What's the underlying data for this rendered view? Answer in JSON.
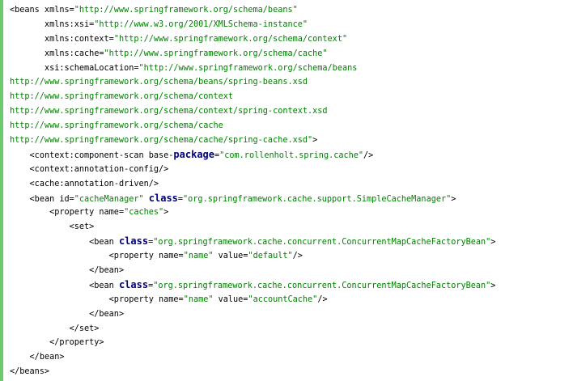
{
  "colors": {
    "left_bar": "#6ccb6c",
    "text": "#000000",
    "string": "#008000",
    "keyword": "#000080"
  },
  "lines": [
    {
      "indent": "",
      "parts": [
        {
          "t": "t",
          "v": "<beans xmlns="
        },
        {
          "t": "s",
          "v": "\"http://www.springframework.org/schema/beans\""
        }
      ]
    },
    {
      "indent": "       ",
      "parts": [
        {
          "t": "t",
          "v": "xmlns:xsi="
        },
        {
          "t": "s",
          "v": "\"http://www.w3.org/2001/XMLSchema-instance\""
        }
      ]
    },
    {
      "indent": "       ",
      "parts": [
        {
          "t": "t",
          "v": "xmlns:context="
        },
        {
          "t": "s",
          "v": "\"http://www.springframework.org/schema/context\""
        }
      ]
    },
    {
      "indent": "       ",
      "parts": [
        {
          "t": "t",
          "v": "xmlns:cache="
        },
        {
          "t": "s",
          "v": "\"http://www.springframework.org/schema/cache\""
        }
      ]
    },
    {
      "indent": "       ",
      "parts": [
        {
          "t": "t",
          "v": "xsi:schemaLocation="
        },
        {
          "t": "s",
          "v": "\"http://www.springframework.org/schema/beans"
        }
      ]
    },
    {
      "indent": "",
      "parts": [
        {
          "t": "s",
          "v": "http://www.springframework.org/schema/beans/spring-beans.xsd"
        }
      ]
    },
    {
      "indent": "",
      "parts": [
        {
          "t": "s",
          "v": "http://www.springframework.org/schema/context"
        }
      ]
    },
    {
      "indent": "",
      "parts": [
        {
          "t": "s",
          "v": "http://www.springframework.org/schema/context/spring-context.xsd"
        }
      ]
    },
    {
      "indent": "",
      "parts": [
        {
          "t": "s",
          "v": "http://www.springframework.org/schema/cache"
        }
      ]
    },
    {
      "indent": "",
      "parts": [
        {
          "t": "s",
          "v": "http://www.springframework.org/schema/cache/spring-cache.xsd\""
        },
        {
          "t": "t",
          "v": ">"
        }
      ]
    },
    {
      "indent": "    ",
      "parts": [
        {
          "t": "t",
          "v": "<context:component-scan base-"
        },
        {
          "t": "k",
          "v": "package"
        },
        {
          "t": "t",
          "v": "="
        },
        {
          "t": "s",
          "v": "\"com.rollenholt.spring.cache\""
        },
        {
          "t": "t",
          "v": "/>"
        }
      ]
    },
    {
      "indent": "    ",
      "parts": [
        {
          "t": "t",
          "v": "<context:annotation-config/>"
        }
      ]
    },
    {
      "indent": "    ",
      "parts": [
        {
          "t": "t",
          "v": "<cache:annotation-driven/>"
        }
      ]
    },
    {
      "indent": "    ",
      "parts": [
        {
          "t": "t",
          "v": "<bean id="
        },
        {
          "t": "s",
          "v": "\"cacheManager\""
        },
        {
          "t": "t",
          "v": " "
        },
        {
          "t": "k",
          "v": "class"
        },
        {
          "t": "t",
          "v": "="
        },
        {
          "t": "s",
          "v": "\"org.springframework.cache.support.SimpleCacheManager\""
        },
        {
          "t": "t",
          "v": ">"
        }
      ]
    },
    {
      "indent": "        ",
      "parts": [
        {
          "t": "t",
          "v": "<property name="
        },
        {
          "t": "s",
          "v": "\"caches\""
        },
        {
          "t": "t",
          "v": ">"
        }
      ]
    },
    {
      "indent": "            ",
      "parts": [
        {
          "t": "t",
          "v": "<set>"
        }
      ]
    },
    {
      "indent": "                ",
      "parts": [
        {
          "t": "t",
          "v": "<bean "
        },
        {
          "t": "k",
          "v": "class"
        },
        {
          "t": "t",
          "v": "="
        },
        {
          "t": "s",
          "v": "\"org.springframework.cache.concurrent.ConcurrentMapCacheFactoryBean\""
        },
        {
          "t": "t",
          "v": ">"
        }
      ]
    },
    {
      "indent": "                    ",
      "parts": [
        {
          "t": "t",
          "v": "<property name="
        },
        {
          "t": "s",
          "v": "\"name\""
        },
        {
          "t": "t",
          "v": " value="
        },
        {
          "t": "s",
          "v": "\"default\""
        },
        {
          "t": "t",
          "v": "/>"
        }
      ]
    },
    {
      "indent": "                ",
      "parts": [
        {
          "t": "t",
          "v": "</bean>"
        }
      ]
    },
    {
      "indent": "                ",
      "parts": [
        {
          "t": "t",
          "v": "<bean "
        },
        {
          "t": "k",
          "v": "class"
        },
        {
          "t": "t",
          "v": "="
        },
        {
          "t": "s",
          "v": "\"org.springframework.cache.concurrent.ConcurrentMapCacheFactoryBean\""
        },
        {
          "t": "t",
          "v": ">"
        }
      ]
    },
    {
      "indent": "                    ",
      "parts": [
        {
          "t": "t",
          "v": "<property name="
        },
        {
          "t": "s",
          "v": "\"name\""
        },
        {
          "t": "t",
          "v": " value="
        },
        {
          "t": "s",
          "v": "\"accountCache\""
        },
        {
          "t": "t",
          "v": "/>"
        }
      ]
    },
    {
      "indent": "                ",
      "parts": [
        {
          "t": "t",
          "v": "</bean>"
        }
      ]
    },
    {
      "indent": "            ",
      "parts": [
        {
          "t": "t",
          "v": "</set>"
        }
      ]
    },
    {
      "indent": "        ",
      "parts": [
        {
          "t": "t",
          "v": "</property>"
        }
      ]
    },
    {
      "indent": "    ",
      "parts": [
        {
          "t": "t",
          "v": "</bean>"
        }
      ]
    },
    {
      "indent": "",
      "parts": [
        {
          "t": "t",
          "v": "</beans>"
        }
      ]
    }
  ]
}
